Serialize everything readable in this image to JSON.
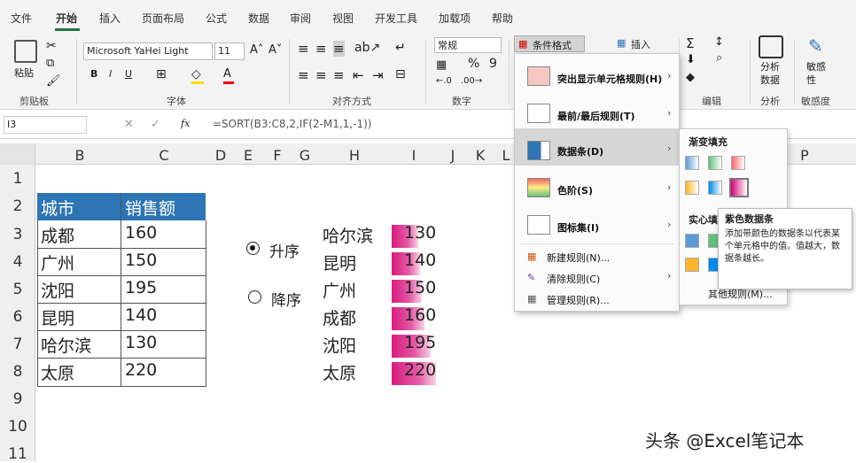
{
  "menu_tabs": [
    "文件",
    "开始",
    "插入",
    "页面布局",
    "公式",
    "数据",
    "审阅",
    "视图",
    "开发工具",
    "加载项",
    "帮助"
  ],
  "ribbon": {
    "paste": "粘贴",
    "font_name": "Microsoft YaHei Light",
    "font_size": "11",
    "number_format": "常规",
    "cond_format": "条件格式",
    "insert": "插入",
    "analyze": "分析\n数据",
    "sensitivity": "敏感\n性",
    "groups": {
      "clipboard": "剪贴板",
      "font": "字体",
      "align": "对齐方式",
      "number": "数字",
      "edit": "编辑",
      "analysis": "分析",
      "sensitivity": "敏感度"
    }
  },
  "formula_bar": {
    "name_box": "I3",
    "formula": "=SORT(B3:C8,2,IF(2-M1,1,-1))",
    "fx": "fx"
  },
  "columns": [
    "B",
    "C",
    "D",
    "E",
    "F",
    "G",
    "H",
    "I",
    "J",
    "K",
    "L",
    "P"
  ],
  "rows": [
    "1",
    "2",
    "3",
    "4",
    "5",
    "6",
    "7",
    "8",
    "9",
    "10",
    "11"
  ],
  "table": {
    "headers": [
      "城市",
      "销售额"
    ],
    "rows": [
      [
        "成都",
        "160"
      ],
      [
        "广州",
        "150"
      ],
      [
        "沈阳",
        "195"
      ],
      [
        "昆明",
        "140"
      ],
      [
        "哈尔滨",
        "130"
      ],
      [
        "太原",
        "220"
      ]
    ]
  },
  "radios": {
    "asc": "升序",
    "desc": "降序",
    "selected": "asc"
  },
  "sorted": {
    "rows": [
      [
        "哈尔滨",
        "130"
      ],
      [
        "昆明",
        "140"
      ],
      [
        "广州",
        "150"
      ],
      [
        "成都",
        "160"
      ],
      [
        "沈阳",
        "195"
      ],
      [
        "太原",
        "220"
      ]
    ],
    "bar_max": 220
  },
  "cf_menu": {
    "items": [
      "突出显示单元格规则(H)",
      "最前/最后规则(T)",
      "数据条(D)",
      "色阶(S)",
      "图标集(I)"
    ],
    "small": [
      "新建规则(N)...",
      "清除规则(C)",
      "管理规则(R)..."
    ]
  },
  "submenu": {
    "gradient": "渐变填充",
    "solid": "实心填充",
    "more": "其他规则(M)..."
  },
  "tooltip": {
    "title": "紫色数据条",
    "body": "添加带颜色的数据条以代表某个单元格中的值。值越大，数据条越长。"
  },
  "watermark": "头条 @Excel笔记本",
  "colors": {
    "header_blue": "#2e75b6",
    "bar": "#d81b7f",
    "excel_green": "#217346"
  }
}
